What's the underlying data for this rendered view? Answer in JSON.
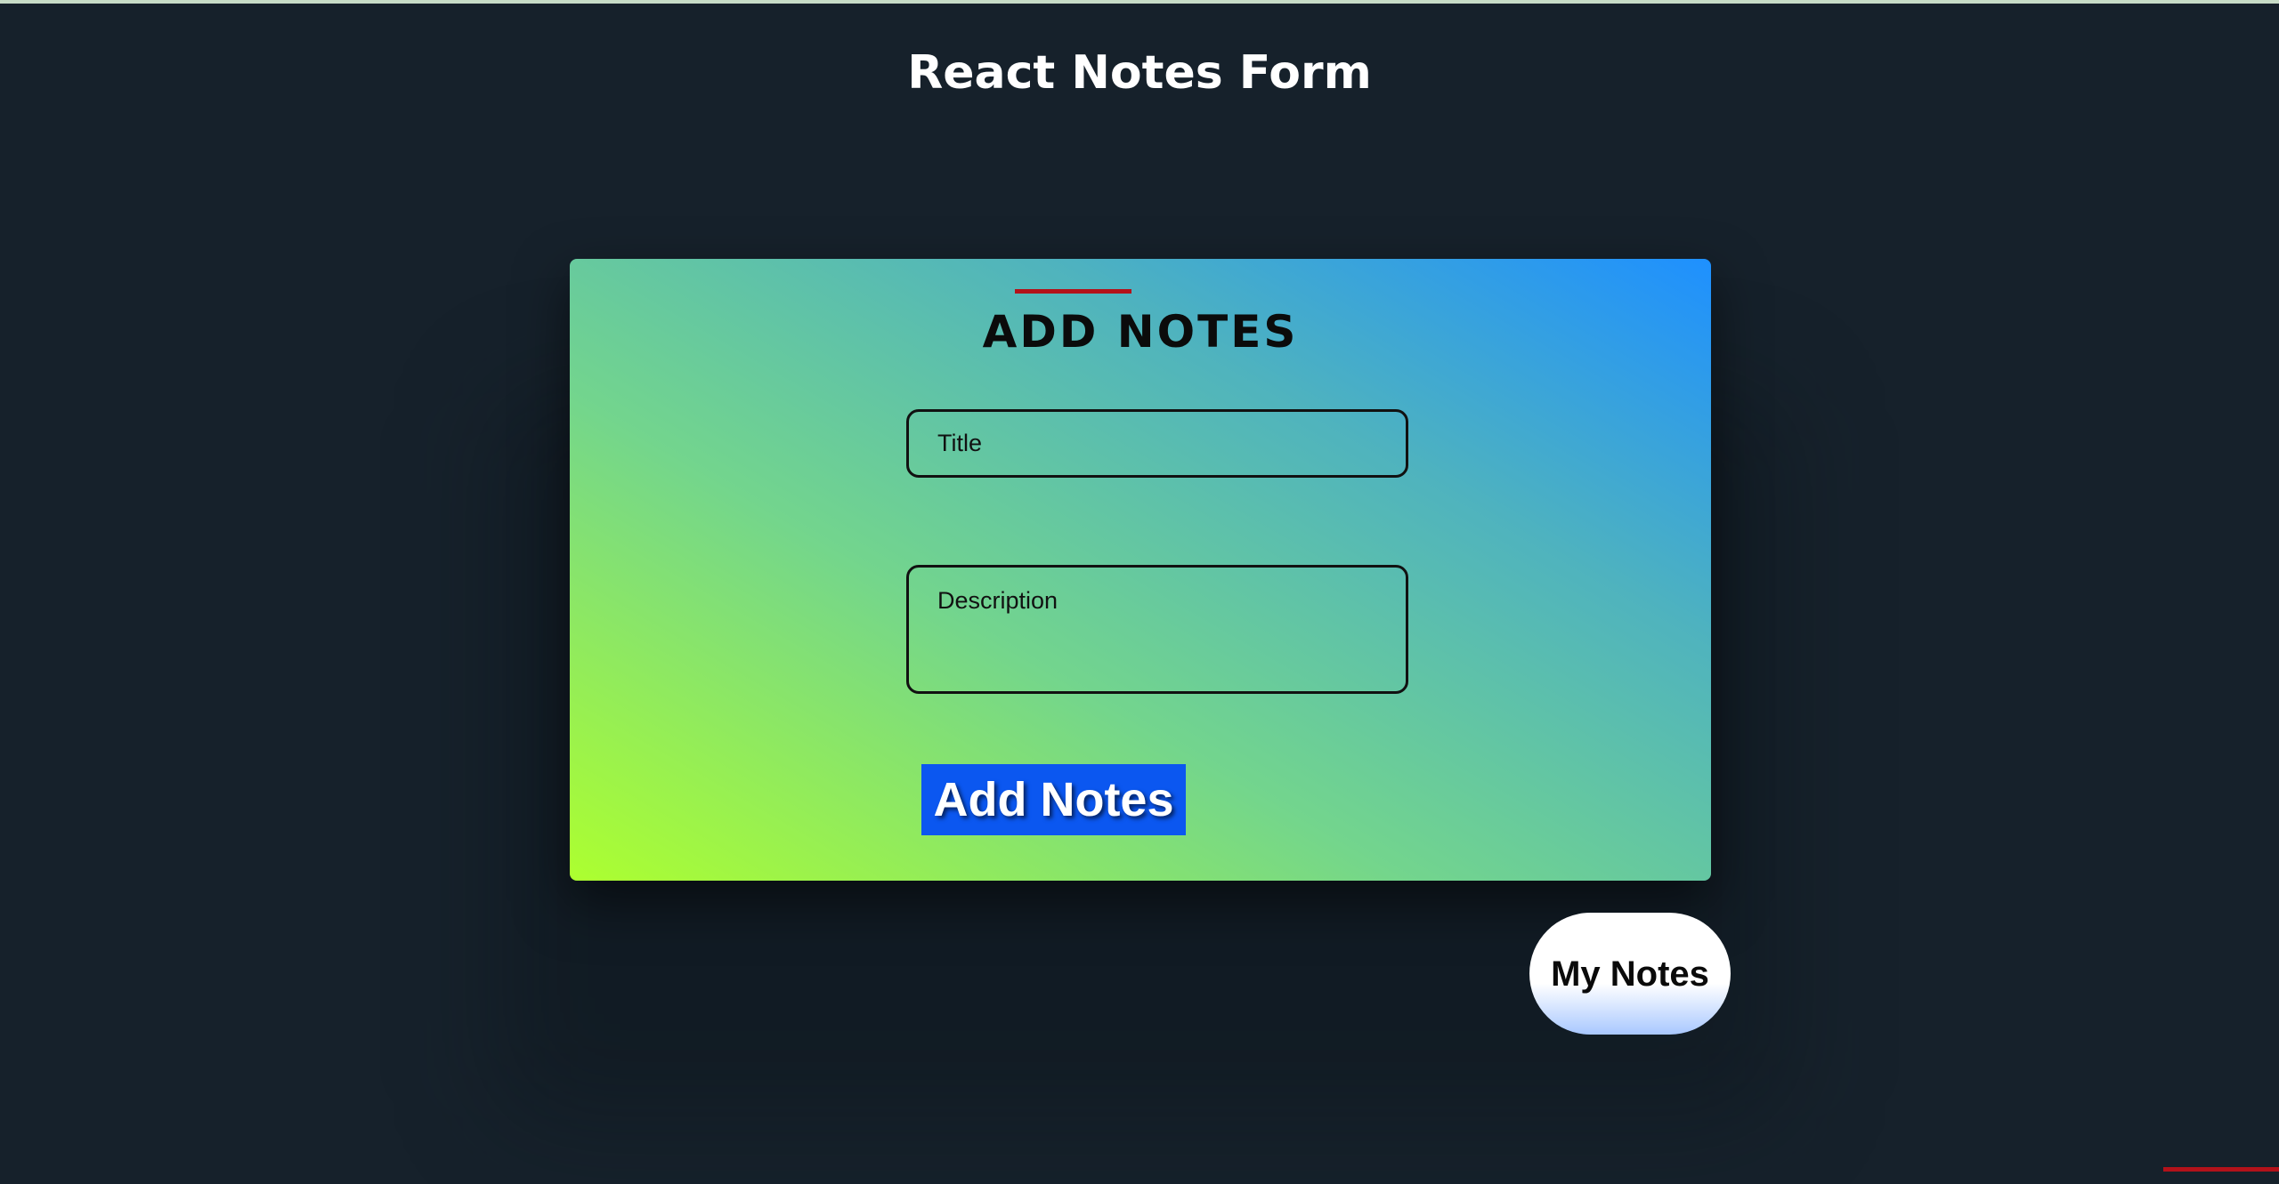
{
  "header": {
    "title": "React Notes Form"
  },
  "form": {
    "heading": "ADD NOTES",
    "title_placeholder": "Title",
    "title_value": "",
    "description_placeholder": "Description",
    "description_value": "",
    "submit_label": "Add Notes"
  },
  "actions": {
    "my_notes_label": "My Notes"
  },
  "colors": {
    "background": "#16212b",
    "gradient_start": "#adff2f",
    "gradient_end": "#1e90ff",
    "accent_red": "#b3121a",
    "button_blue": "#0b57f0"
  }
}
